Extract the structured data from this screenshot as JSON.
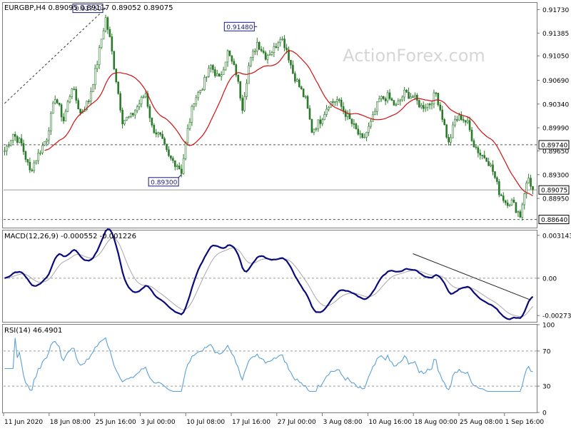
{
  "chart_data": [
    {
      "type": "candlestick",
      "panel": "price",
      "title": "EURGBP,H4",
      "ohlc_label": "0.89095 0.89117 0.89052 0.89075",
      "watermark": "ActionForex.com",
      "y_ticks": [
        "0.91730",
        "0.91385",
        "0.91050",
        "0.90690",
        "0.90340",
        "0.89990",
        "0.89650",
        "0.89300",
        "0.88950"
      ],
      "ylim": [
        0.8852,
        0.9183
      ],
      "level_markers": [
        {
          "value": 0.8974,
          "label": "0.89740",
          "style": "dashed",
          "side": "right"
        },
        {
          "value": 0.8864,
          "label": "0.88640",
          "style": "dashed",
          "side": "right"
        },
        {
          "value": 0.89075,
          "label": "0.89075",
          "style": "solid",
          "side": "right",
          "current": true
        }
      ],
      "annotations": [
        {
          "label": "0.91750",
          "value": 0.9175,
          "bar": 48
        },
        {
          "label": "0.91480",
          "value": 0.9148,
          "bar": 120
        },
        {
          "label": "0.89300",
          "value": 0.893,
          "bar": 84
        }
      ],
      "trendline_start": {
        "bar": 0,
        "value": 0.9035
      },
      "trendline_end": {
        "bar": 48,
        "value": 0.9175
      },
      "ma_color": "#d01010",
      "up_color": "#2a7a2a",
      "down_color": "#2a7a2a",
      "keypoints": [
        [
          0,
          0.8965
        ],
        [
          4,
          0.899
        ],
        [
          8,
          0.8975
        ],
        [
          12,
          0.8935
        ],
        [
          16,
          0.896
        ],
        [
          20,
          0.8985
        ],
        [
          24,
          0.9045
        ],
        [
          28,
          0.901
        ],
        [
          32,
          0.906
        ],
        [
          36,
          0.902
        ],
        [
          40,
          0.904
        ],
        [
          44,
          0.9095
        ],
        [
          46,
          0.913
        ],
        [
          48,
          0.916
        ],
        [
          50,
          0.913
        ],
        [
          53,
          0.907
        ],
        [
          56,
          0.901
        ],
        [
          60,
          0.9015
        ],
        [
          64,
          0.9035
        ],
        [
          67,
          0.905
        ],
        [
          70,
          0.9
        ],
        [
          74,
          0.8985
        ],
        [
          78,
          0.8955
        ],
        [
          82,
          0.8945
        ],
        [
          84,
          0.8935
        ],
        [
          87,
          0.8995
        ],
        [
          90,
          0.904
        ],
        [
          94,
          0.906
        ],
        [
          98,
          0.909
        ],
        [
          102,
          0.907
        ],
        [
          106,
          0.911
        ],
        [
          110,
          0.908
        ],
        [
          113,
          0.903
        ],
        [
          116,
          0.909
        ],
        [
          120,
          0.9125
        ],
        [
          124,
          0.9105
        ],
        [
          128,
          0.9115
        ],
        [
          131,
          0.9135
        ],
        [
          134,
          0.9115
        ],
        [
          137,
          0.908
        ],
        [
          140,
          0.906
        ],
        [
          143,
          0.904
        ],
        [
          146,
          0.8995
        ],
        [
          150,
          0.901
        ],
        [
          154,
          0.9035
        ],
        [
          158,
          0.904
        ],
        [
          162,
          0.902
        ],
        [
          166,
          0.9
        ],
        [
          170,
          0.898
        ],
        [
          174,
          0.9005
        ],
        [
          178,
          0.904
        ],
        [
          182,
          0.9045
        ],
        [
          186,
          0.903
        ],
        [
          190,
          0.905
        ],
        [
          194,
          0.9045
        ],
        [
          198,
          0.903
        ],
        [
          202,
          0.9035
        ],
        [
          205,
          0.905
        ],
        [
          208,
          0.9015
        ],
        [
          211,
          0.8975
        ],
        [
          214,
          0.901
        ],
        [
          217,
          0.9015
        ],
        [
          220,
          0.9005
        ],
        [
          223,
          0.8975
        ],
        [
          226,
          0.896
        ],
        [
          229,
          0.8955
        ],
        [
          232,
          0.8935
        ],
        [
          235,
          0.8905
        ],
        [
          238,
          0.889
        ],
        [
          241,
          0.889
        ],
        [
          243,
          0.888
        ],
        [
          245,
          0.887
        ],
        [
          247,
          0.8905
        ],
        [
          249,
          0.8925
        ],
        [
          251,
          0.8907
        ]
      ],
      "ma_period": 20
    },
    {
      "type": "line",
      "panel": "macd",
      "label": "MACD(12,26,9) -0.000552 -0.001226",
      "y_ticks": [
        "0.003143",
        "0.00",
        "-0.002737"
      ],
      "ylim": [
        -0.0032,
        0.0035
      ],
      "main_color": "#0a0a7a",
      "signal_color": "#a8a8a8",
      "trendline_start": {
        "bar": 194,
        "value": 0.0018
      },
      "trendline_end": {
        "bar": 250,
        "value": -0.0016
      }
    },
    {
      "type": "line",
      "panel": "rsi",
      "label": "RSI(14) 46.4901",
      "y_ticks": [
        "100",
        "70",
        "30",
        "0"
      ],
      "levels": [
        70,
        30
      ],
      "ylim": [
        0,
        100
      ],
      "line_color": "#5aa0d8"
    }
  ],
  "x_axis_labels": [
    "11 Jun 2020",
    "18 Jun 08:00",
    "25 Jun 16:00",
    "3 Jul 00:00",
    "10 Jul 08:00",
    "17 Jul 16:00",
    "27 Jul 00:00",
    "3 Aug 08:00",
    "10 Aug 16:00",
    "18 Aug 00:00",
    "25 Aug 08:00",
    "1 Sep 16:00"
  ],
  "bar_count": 252
}
